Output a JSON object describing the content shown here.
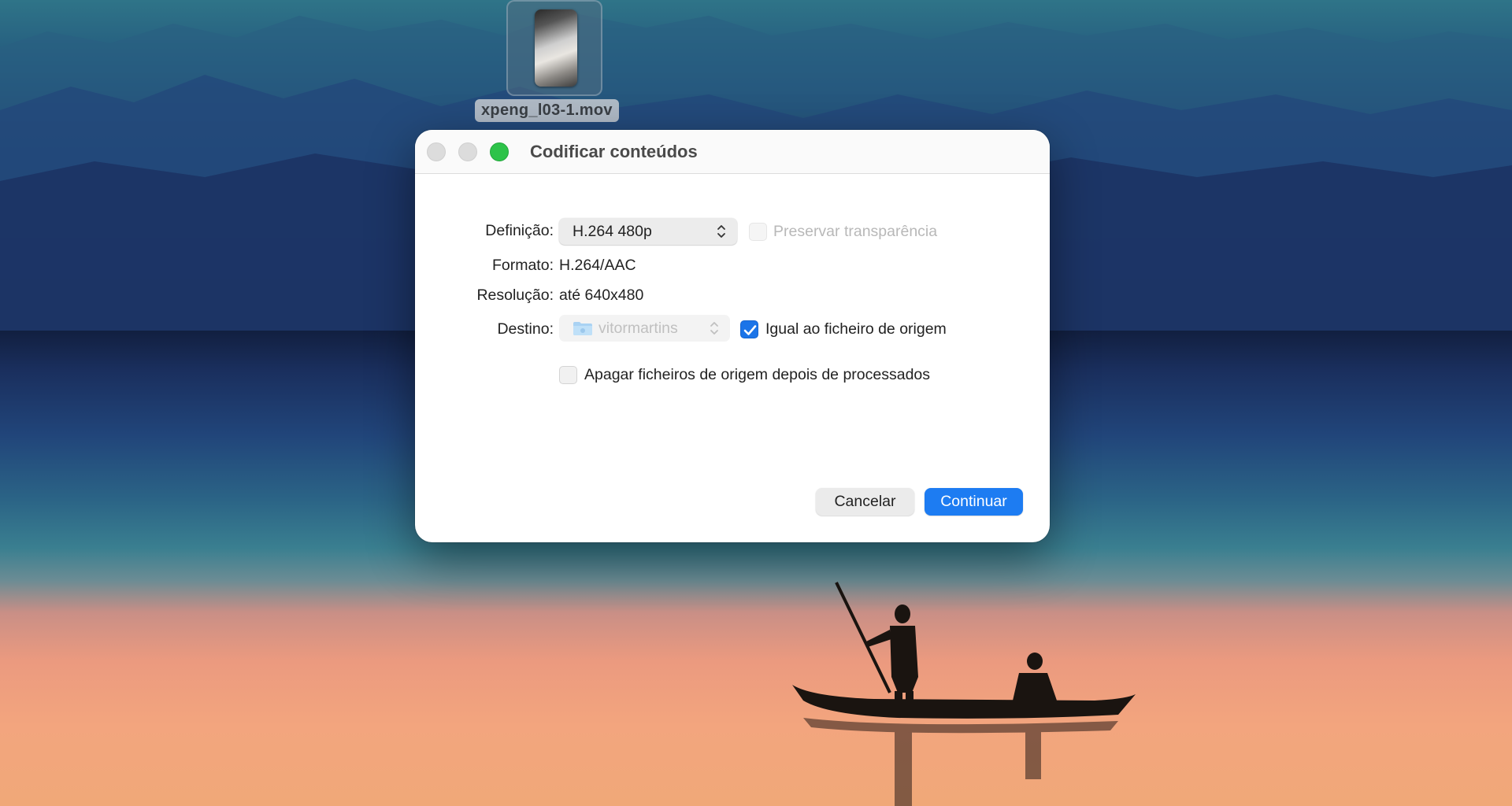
{
  "desktop": {
    "file": {
      "name": "xpeng_l03-1.mov"
    }
  },
  "dialog": {
    "title": "Codificar conteúdos",
    "definition": {
      "label": "Definição:",
      "selected": "H.264 480p",
      "preserve_transparency": {
        "label": "Preservar transparência",
        "checked": false,
        "enabled": false
      }
    },
    "format": {
      "label": "Formato:",
      "value": "H.264/AAC"
    },
    "resolution": {
      "label": "Resolução:",
      "value": "até 640x480"
    },
    "destination": {
      "label": "Destino:",
      "selected": "vitormartins",
      "same_as_source": {
        "label": "Igual ao ficheiro de origem",
        "checked": true
      }
    },
    "delete_sources": {
      "label": "Apagar ficheiros de origem depois de processados",
      "checked": false
    },
    "buttons": {
      "cancel": "Cancelar",
      "continue": "Continuar"
    },
    "colors": {
      "accent": "#1d7cf2",
      "zoom": "#2dc349"
    }
  }
}
